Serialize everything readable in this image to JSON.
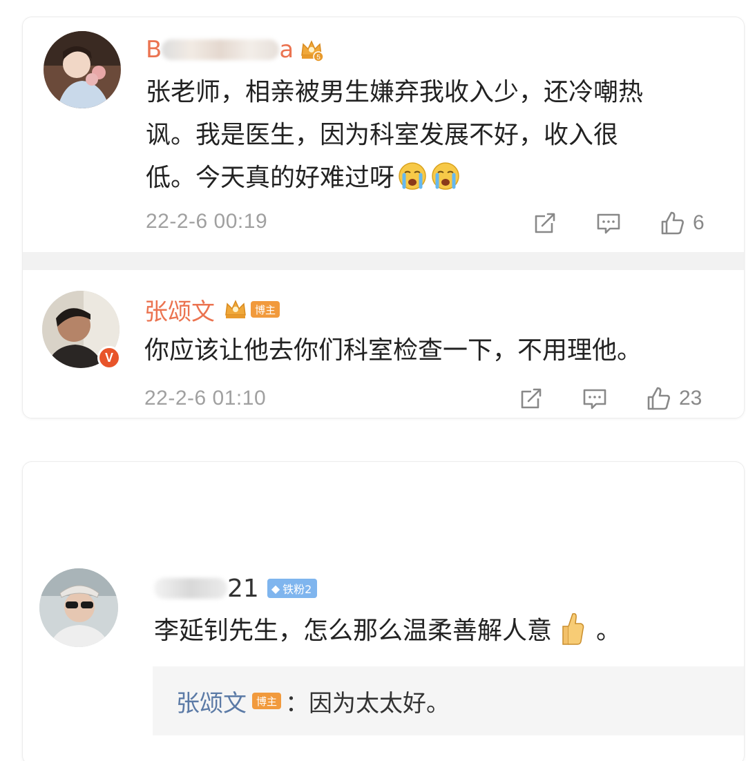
{
  "comments": [
    {
      "author_visible": "B",
      "author_suffix": "a",
      "crown_level": "5",
      "text_line1": "张老师，相亲被男生嫌弃我收入少，还冷嘲热",
      "text_line2": "讽。我是医生，因为科室发展不好，收入很",
      "text_line3": "低。今天真的好难过呀",
      "emoji": "crying-face",
      "timestamp": "22-2-6 00:19",
      "likes": "6"
    },
    {
      "author": "张颂文",
      "tag": "博主",
      "verified": "V",
      "text": "你应该让他去你们科室检查一下，不用理他。",
      "timestamp": "22-2-6 01:10",
      "likes": "23"
    },
    {
      "author_visible": "21",
      "tag": "铁粉2",
      "text": "李延钊先生，怎么那么温柔善解人意",
      "emoji": "thumbs-up",
      "text_end": "。",
      "reply": {
        "author": "张颂文",
        "tag": "博主",
        "text": "：因为太太好。"
      }
    }
  ],
  "colors": {
    "accent_name": "#eb7350",
    "tag_bozhu": "#f19a3d",
    "tag_fans": "#7fb5ee",
    "reply_name": "#5b7aa6",
    "verified": "#e8542a"
  }
}
